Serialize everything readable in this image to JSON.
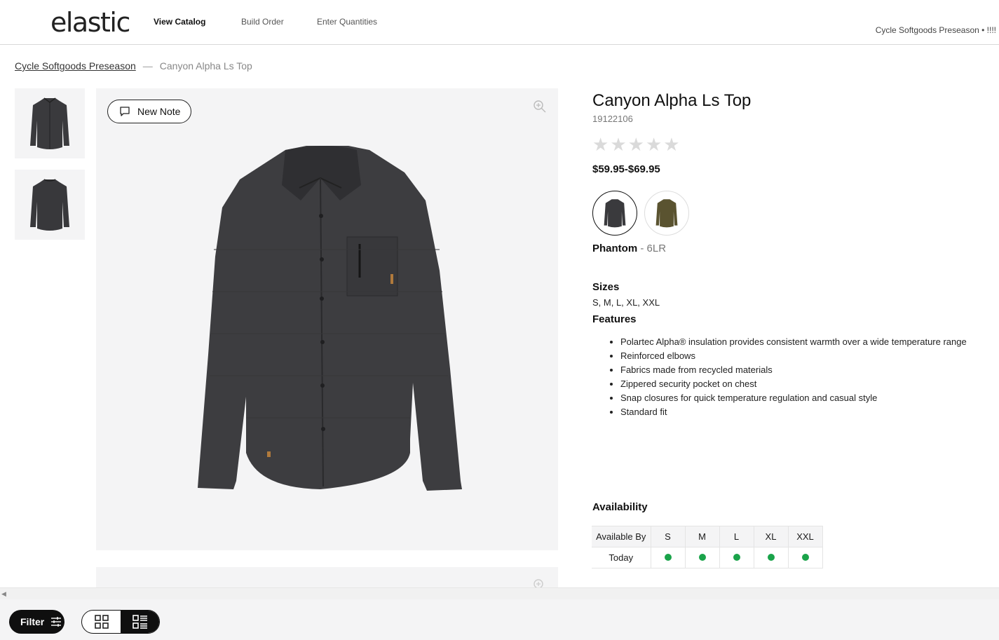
{
  "header": {
    "logo": "elastic",
    "nav": [
      "View Catalog",
      "Build Order",
      "Enter Quantities"
    ],
    "account": "Cycle Softgoods Preseason • !!!!"
  },
  "breadcrumb": {
    "parent": "Cycle Softgoods Preseason",
    "separator": "—",
    "current": "Canyon Alpha Ls Top"
  },
  "gallery": {
    "new_note_label": "New Note"
  },
  "product": {
    "title": "Canyon Alpha Ls Top",
    "sku": "19122106",
    "rating": 0,
    "price": "$59.95-$69.95",
    "selected_color": {
      "name": "Phantom",
      "separator": " - ",
      "code": "6LR"
    },
    "swatch_colors": [
      "#3a3a3d",
      "#5a5330"
    ],
    "sizes_heading": "Sizes",
    "sizes": "S, M, L, XL, XXL",
    "features_heading": "Features",
    "features": [
      "Polartec Alpha® insulation provides consistent warmth over a wide temperature range",
      "Reinforced elbows",
      "Fabrics made from recycled materials",
      "Zippered security pocket on chest",
      "Snap closures for quick temperature regulation and casual style",
      "Standard fit"
    ]
  },
  "availability": {
    "heading": "Availability",
    "header_label": "Available By",
    "sizes": [
      "S",
      "M",
      "L",
      "XL",
      "XXL"
    ],
    "row_label": "Today",
    "status_color": "#1aa34a"
  },
  "bottom": {
    "filter_label": "Filter"
  }
}
